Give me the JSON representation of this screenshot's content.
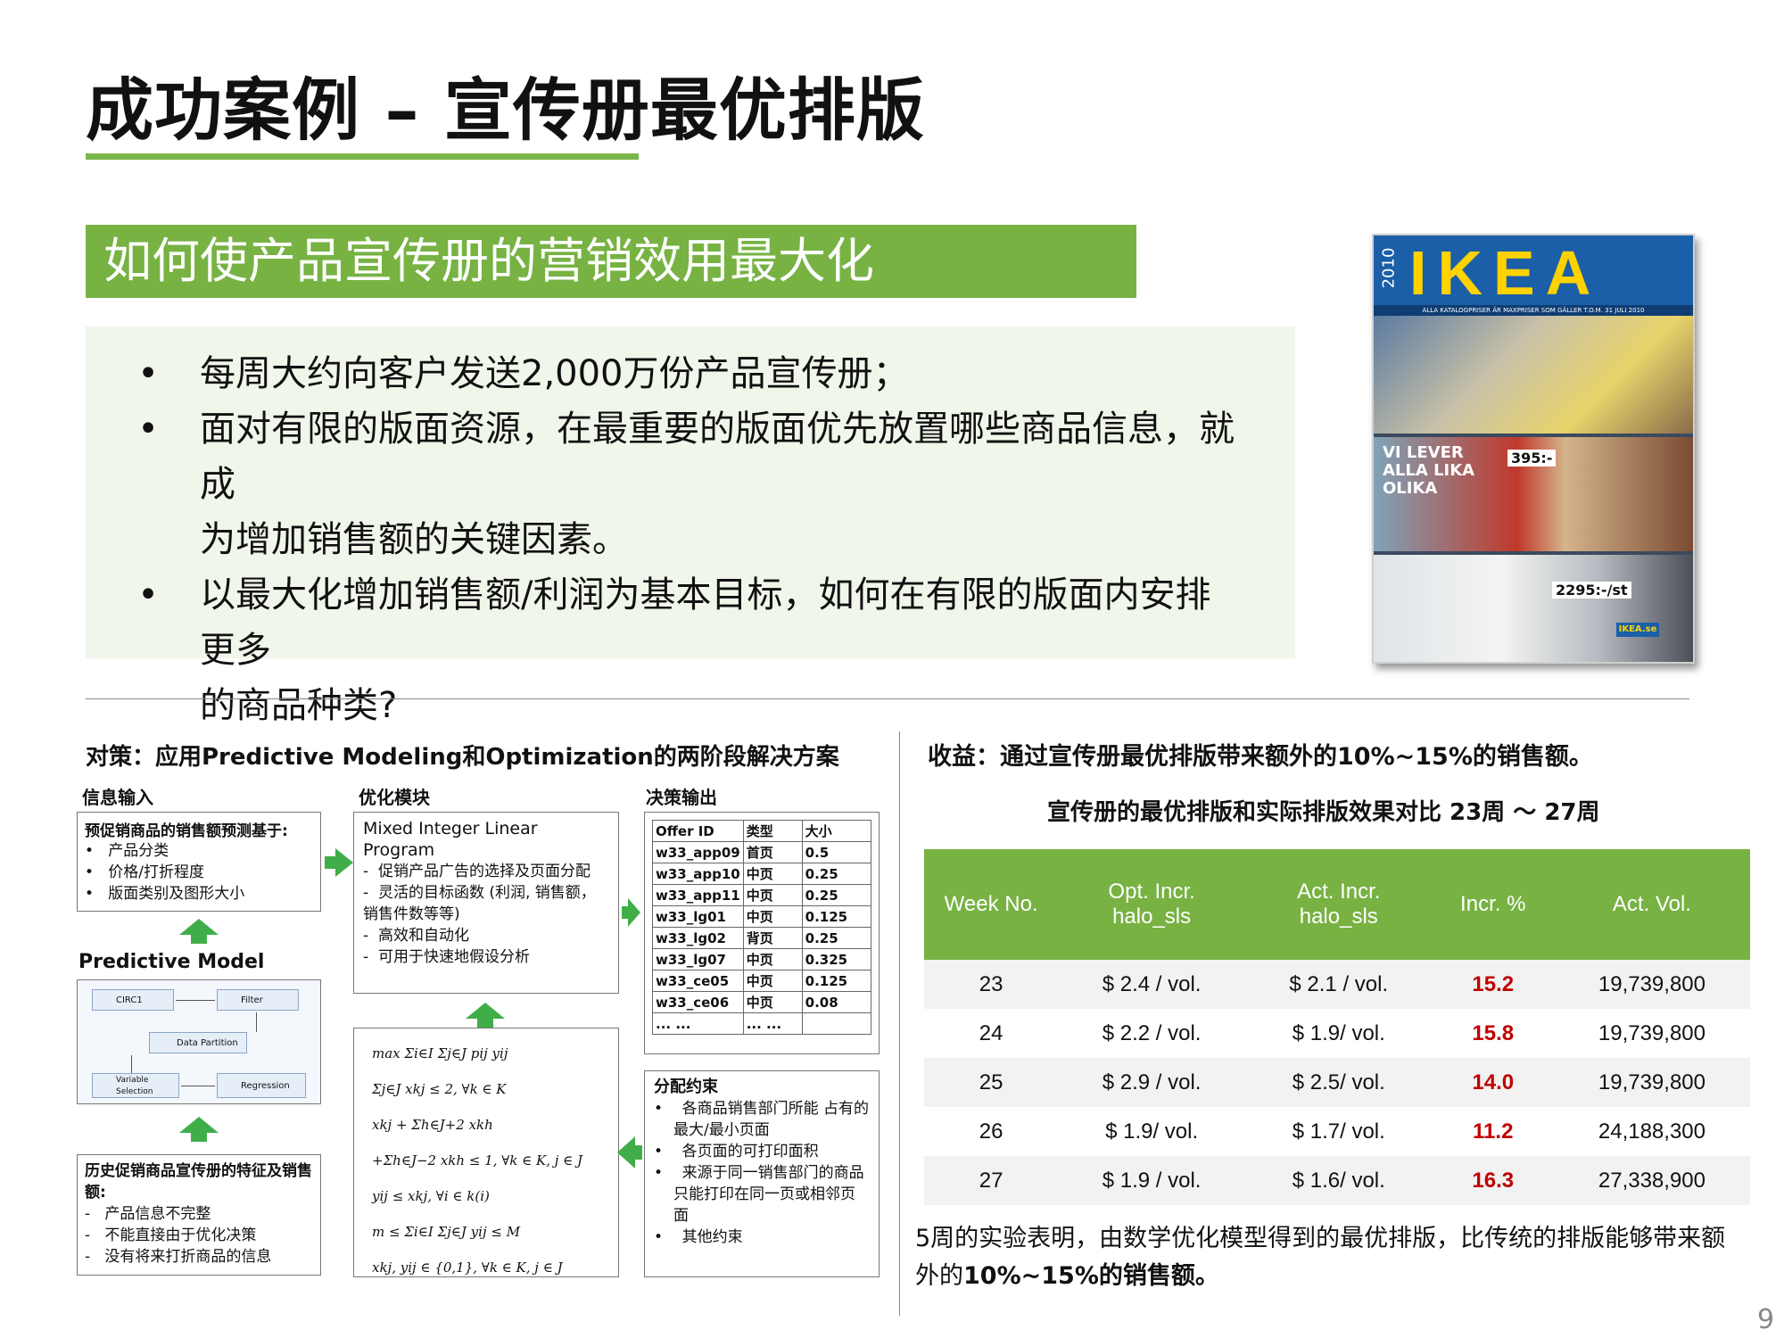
{
  "page_title": "成功案例 – 宣传册最优排版",
  "subtitle": "如何使产品宣传册的营销效用最大化",
  "bullets": [
    {
      "line1": "每周大约向客户发送2,000万份产品宣传册；",
      "line2": ""
    },
    {
      "line1": "面对有限的版面资源，在最重要的版面优先放置哪些商品信息，就成",
      "line2": "为增加销售额的关键因素。"
    },
    {
      "line1": "以最大化增加销售额/利润为基本目标，如何在有限的版面内安排更多",
      "line2": "的商品种类?"
    }
  ],
  "bullet_symbol": "•",
  "catalog": {
    "brand": "IKEA",
    "year": "2010",
    "top_text": "ALLA KATALOGPRISER ÄR MAXPRISER SOM GÄLLER T.O.M. 31 JULI 2010",
    "side_text": "VI LEVER ALLA LIKA OLIKA",
    "price1": "395:-",
    "price2": "2295:-/st",
    "footer": "IKEA.se"
  },
  "strategy": {
    "heading": "对策：应用Predictive Modeling和Optimization的两阶段解决方案",
    "col_input": "信息输入",
    "col_opt": "优化模块",
    "col_output": "决策输出",
    "input_box": {
      "title": "预促销商品的销售额预测基于:",
      "items": [
        "产品分类",
        "价格/打折程度",
        "版面类别及图形大小"
      ]
    },
    "predictive_model_label": "Predictive Model",
    "model_nodes": [
      "CIRC1",
      "Filter",
      "Data Partition",
      "Variable Selection",
      "Regression"
    ],
    "history_box": {
      "title": "历史促销商品宣传册的特征及销售额:",
      "items": [
        "产品信息不完整",
        "不能直接由于优化决策",
        "没有将来打折商品的信息"
      ]
    },
    "milp_box": {
      "title": "Mixed Integer Linear Program",
      "items": [
        "促销产品广告的选择及页面分配",
        "灵活的目标函数 (利润, 销售额，销售件数等等)",
        "高效和自动化",
        "可用于快速地假设分析"
      ]
    },
    "formulas": [
      "max Σi∈I Σj∈J pij yij",
      "Σj∈J xkj ≤ 2, ∀k ∈ K",
      "xkj + Σh∈J+2 xkh",
      "+Σh∈J−2 xkh ≤ 1, ∀k ∈ K, j ∈ J",
      "yij ≤ xkj, ∀i ∈ k(i)",
      "m ≤ Σi∈I Σj∈J yij ≤ M",
      "xkj, yij ∈ {0,1}, ∀k ∈ K, j ∈ J"
    ],
    "offer_table": {
      "headers": [
        "Offer ID",
        "类型",
        "大小"
      ],
      "rows": [
        [
          "w33_app09",
          "首页",
          "0.5"
        ],
        [
          "w33_app10",
          "中页",
          "0.25"
        ],
        [
          "w33_app11",
          "中页",
          "0.25"
        ],
        [
          "w33_lg01",
          "中页",
          "0.125"
        ],
        [
          "w33_lg02",
          "背页",
          "0.25"
        ],
        [
          "w33_lg07",
          "中页",
          "0.325"
        ],
        [
          "w33_ce05",
          "中页",
          "0.125"
        ],
        [
          "w33_ce06",
          "中页",
          "0.08"
        ],
        [
          "... ...",
          "... ...",
          ""
        ]
      ]
    },
    "constraints_box": {
      "title": "分配约束",
      "items": [
        "各商品销售部门所能 占有的最大/最小页面",
        "各页面的可打印面积",
        "来源于同一销售部门的商品只能打印在同一页或相邻页面",
        "其他约束"
      ]
    }
  },
  "benefit": {
    "heading": "收益：通过宣传册最优排版带来额外的10%~15%的销售额。",
    "table_title": "宣传册的最优排版和实际排版效果对比 23周 ～ 27周",
    "headers": [
      "Week No.",
      "Opt. Incr.\nhalo_sls",
      "Act. Incr.\nhalo_sls",
      "Incr. %",
      "Act. Vol."
    ],
    "rows": [
      [
        "23",
        "$ 2.4 / vol.",
        "$ 2.1 / vol.",
        "15.2",
        "19,739,800"
      ],
      [
        "24",
        "$ 2.2 / vol.",
        "$ 1.9/ vol.",
        "15.8",
        "19,739,800"
      ],
      [
        "25",
        "$ 2.9 / vol.",
        "$ 2.5/ vol.",
        "14.0",
        "19,739,800"
      ],
      [
        "26",
        "$ 1.9/ vol.",
        "$ 1.7/ vol.",
        "11.2",
        "24,188,300"
      ],
      [
        "27",
        "$ 1.9 / vol.",
        "$ 1.6/ vol.",
        "16.3",
        "27,338,900"
      ]
    ],
    "conclusion_line1": "5周的实验表明，由数学优化模型得到的最优排版，比传统的排版能够带来额",
    "conclusion_line2_a": "外的",
    "conclusion_line2_b": "10%~15%的销售额。"
  },
  "page_number": "9",
  "colors": {
    "accent_green": "#77b243",
    "arrow_green": "#3fae49",
    "pct_red": "#c00000"
  }
}
